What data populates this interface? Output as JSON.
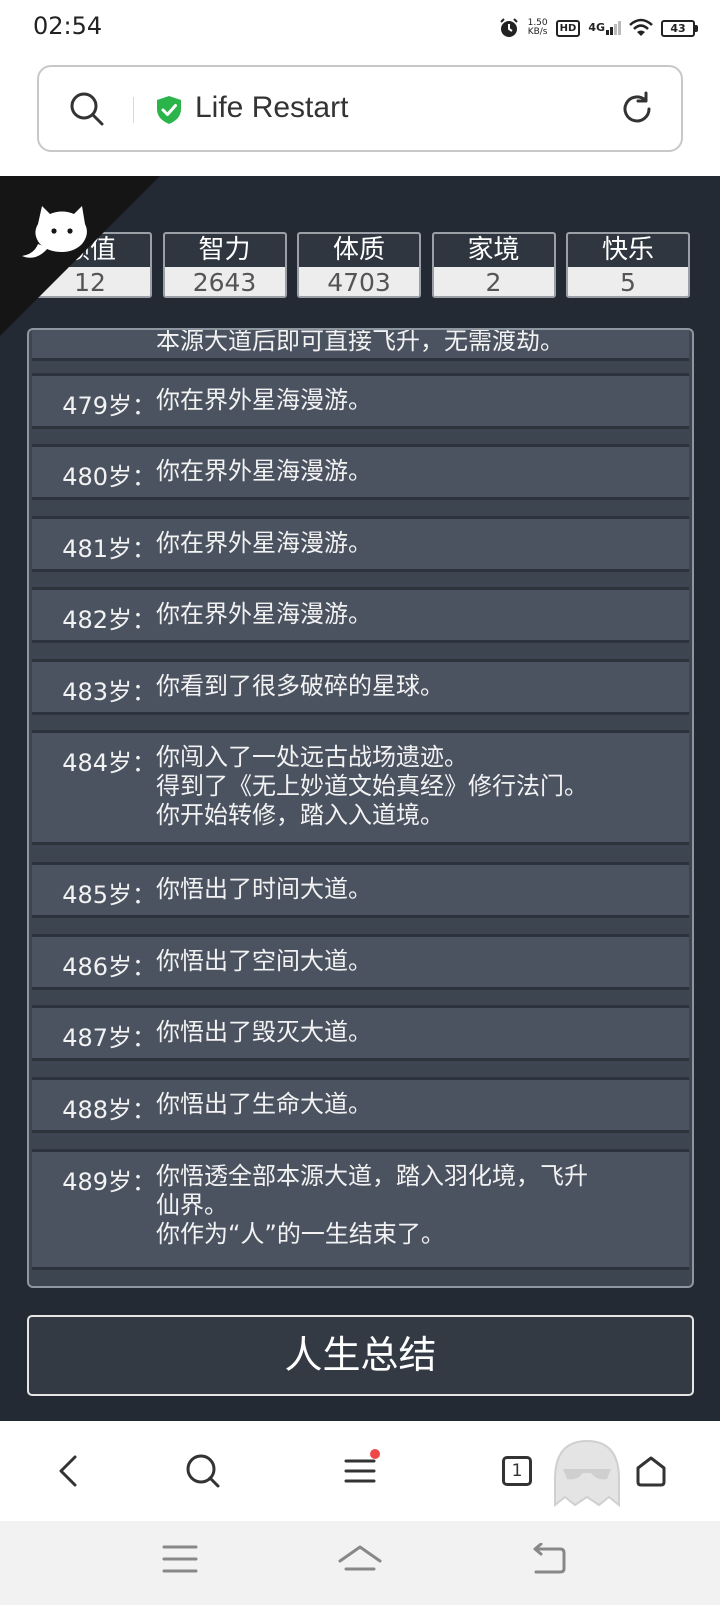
{
  "status_bar": {
    "time": "02:54",
    "speed_value": "1.50",
    "speed_unit": "KB/s",
    "hd": "HD",
    "network": "4G",
    "battery": "43"
  },
  "browser": {
    "title": "Life Restart",
    "tab_count": "1"
  },
  "stats": [
    {
      "label": "颜值",
      "value": "12"
    },
    {
      "label": "智力",
      "value": "2643"
    },
    {
      "label": "体质",
      "value": "4703"
    },
    {
      "label": "家境",
      "value": "2"
    },
    {
      "label": "快乐",
      "value": "5"
    }
  ],
  "log": {
    "partial_top": "本源大道后即可直接飞升，无需渡劫。",
    "rows": [
      {
        "age": "479岁：",
        "lines": [
          "你在界外星海漫游。"
        ]
      },
      {
        "age": "480岁：",
        "lines": [
          "你在界外星海漫游。"
        ]
      },
      {
        "age": "481岁：",
        "lines": [
          "你在界外星海漫游。"
        ]
      },
      {
        "age": "482岁：",
        "lines": [
          "你在界外星海漫游。"
        ]
      },
      {
        "age": "483岁：",
        "lines": [
          "你看到了很多破碎的星球。"
        ]
      },
      {
        "age": "484岁：",
        "lines": [
          "你闯入了一处远古战场遗迹。",
          "得到了《无上妙道文始真经》修行法门。",
          "你开始转修，踏入入道境。"
        ]
      },
      {
        "age": "485岁：",
        "lines": [
          "你悟出了时间大道。"
        ]
      },
      {
        "age": "486岁：",
        "lines": [
          "你悟出了空间大道。"
        ]
      },
      {
        "age": "487岁：",
        "lines": [
          "你悟出了毁灭大道。"
        ]
      },
      {
        "age": "488岁：",
        "lines": [
          "你悟出了生命大道。"
        ]
      },
      {
        "age": "489岁：",
        "lines": [
          "你悟透全部本源大道，踏入羽化境，飞升",
          "仙界。",
          "你作为“人”的一生结束了。"
        ]
      }
    ]
  },
  "summary_button": "人生总结",
  "colors": {
    "page_bg": "#232a33",
    "row_bg": "#4b5361",
    "shield": "#2bb44a",
    "notify_dot": "#f04848"
  },
  "icons": [
    "search-icon",
    "shield-check-icon",
    "reload-icon",
    "github-cat-icon",
    "back-icon",
    "menu-icon",
    "tabs-icon",
    "home-icon",
    "ghost-icon"
  ]
}
